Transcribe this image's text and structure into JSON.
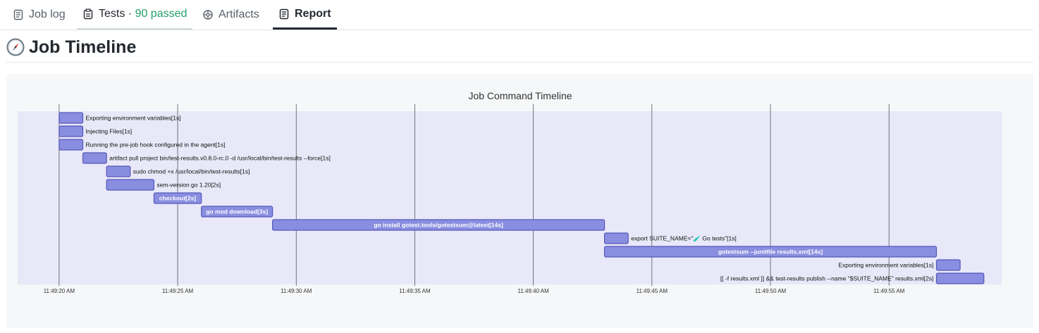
{
  "tabs": [
    {
      "label": "Job log",
      "icon": "document-icon"
    },
    {
      "label": "Tests · ",
      "count_label": "90 passed",
      "icon": "clipboard-icon"
    },
    {
      "label": "Artifacts",
      "icon": "artifact-icon"
    },
    {
      "label": "Report",
      "icon": "report-icon",
      "active": true
    }
  ],
  "page": {
    "title": "Job Timeline",
    "title_icon": "compass-icon"
  },
  "colors": {
    "bar_fill": "#8a8ee0",
    "bar_stroke": "#5457b8",
    "plot_bg": "#e8e8f9",
    "accent_green": "#22a06b"
  },
  "chart_data": {
    "type": "gantt",
    "title": "Job Command Timeline",
    "x_axis": {
      "ticks": [
        "11:49:20 AM",
        "11:49:25 AM",
        "11:49:30 AM",
        "11:49:35 AM",
        "11:49:40 AM",
        "11:49:45 AM",
        "11:49:50 AM",
        "11:49:55 AM"
      ],
      "range_seconds": [
        18.25,
        59.75
      ]
    },
    "tasks": [
      {
        "label": "Exporting environment variables[1s]",
        "start": 20,
        "end": 21,
        "label_pos": "right"
      },
      {
        "label": "Injecting Files[1s]",
        "start": 20,
        "end": 21,
        "label_pos": "right"
      },
      {
        "label": "Running the pre-job hook configured in the agent[1s]",
        "start": 20,
        "end": 21,
        "label_pos": "right"
      },
      {
        "label": "artifact pull project bin/test-results.v0.8.0-rc.0 -d /usr/local/bin/test-results --force[1s]",
        "start": 21,
        "end": 22,
        "label_pos": "right"
      },
      {
        "label": "sudo chmod +x /usr/local/bin/test-results[1s]",
        "start": 22,
        "end": 23,
        "label_pos": "right"
      },
      {
        "label": "sem-version go 1.20[2s]",
        "start": 22,
        "end": 24,
        "label_pos": "right"
      },
      {
        "label": "checkout[2s]",
        "start": 24,
        "end": 26,
        "label_pos": "inside"
      },
      {
        "label": "go mod download[3s]",
        "start": 26,
        "end": 29,
        "label_pos": "inside"
      },
      {
        "label": "go install gotest.tools/gotestsum@latest[14s]",
        "start": 29,
        "end": 43,
        "label_pos": "inside"
      },
      {
        "label": "export SUITE_NAME=\"🧪 Go tests\"[1s]",
        "start": 43,
        "end": 44,
        "label_pos": "right"
      },
      {
        "label": "gotestsum --junitfile results.xml[14s]",
        "start": 43,
        "end": 57,
        "label_pos": "inside"
      },
      {
        "label": "Exporting environment variables[1s]",
        "start": 57,
        "end": 58,
        "label_pos": "left"
      },
      {
        "label": "[[ -f results.xml ]] && test-results publish --name \"$SUITE_NAME\" results.xml[2s]",
        "start": 57,
        "end": 59,
        "label_pos": "left"
      }
    ]
  }
}
